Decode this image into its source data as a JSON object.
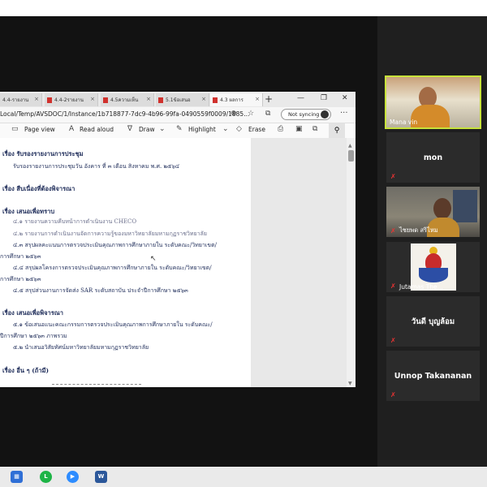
{
  "browser": {
    "tabs": [
      {
        "label": "4.4-รายงาน"
      },
      {
        "label": "4.4-2รายงาน"
      },
      {
        "label": "4.5ความเห็น"
      },
      {
        "label": "5.1ข้อเสนอ"
      },
      {
        "label": "4.3 ผลการ"
      }
    ],
    "new_tab": "+",
    "url": "Local/Temp/AVSDOC/1/Instance/1b718877-7dc9-4b96-99fa-0490559f0009/1885...",
    "sync_label": "Not syncing",
    "more": "···"
  },
  "pdf_toolbar": {
    "page_view": "Page view",
    "read_aloud": "Read aloud",
    "draw": "Draw",
    "highlight": "Highlight",
    "erase": "Erase"
  },
  "document": {
    "lines": [
      {
        "text": "เรื่อง รับรองรายงานการประชุม",
        "type": "h"
      },
      {
        "text": "รับรองรายงานการประชุมวัน อังคาร ที่ ๓ เดือน สิงหาคม พ.ศ. ๒๕๖๔",
        "type": "t"
      },
      {
        "text": "เรื่อง สืบเนื่องที่ต้องพิจารณา",
        "type": "h"
      },
      {
        "text": "เรื่อง เสนอเพื่อทราบ",
        "type": "h"
      },
      {
        "text": "๔.๑ รายงานความคืบหน้าการดำเนินงาน CHECO",
        "type": "t"
      },
      {
        "text": "๔.๒ รายงานการดำเนินงานจัดการความรู้ของมหาวิทยาลัยมหามกุฏราชวิทยาลัย",
        "type": "t"
      },
      {
        "text": "๔.๓ สรุปผลคะแนนการตรวจประเมินคุณภาพการศึกษาภายใน ระดับคณะ/วิทยาเขต/",
        "type": "t"
      },
      {
        "text": "การศึกษา ๒๕๖๓",
        "type": "t"
      },
      {
        "text": "๔.๔ สรุปผลโครงการตรวจประเมินคุณภาพการศึกษาภายใน ระดับคณะ/วิทยาเขต/",
        "type": "t"
      },
      {
        "text": "การศึกษา ๒๕๖๓",
        "type": "t"
      },
      {
        "text": "๔.๕ สรุปส่วนงานการจัดส่ง SAR ระดับสถาบัน ประจำปีการศึกษา ๒๕๖๓",
        "type": "t"
      },
      {
        "text": "เรื่อง เสนอเพื่อพิจารณา",
        "type": "h"
      },
      {
        "text": "๕.๑ ข้อเสนอแนะคณะกรรมการตรวจประเมินคุณภาพการศึกษาภายใน ระดับคณะ/",
        "type": "t"
      },
      {
        "text": "ปีการศึกษา ๒๕๖๓ ภาพรวม",
        "type": "t"
      },
      {
        "text": "๕.๒ นำเสนอวิสัยทัศน์มหาวิทยาลัยมหามกุฏราชวิทยาลัย",
        "type": "t"
      },
      {
        "text": "เรื่อง อื่น ๆ (ถ้ามี)",
        "type": "h"
      }
    ]
  },
  "participants": [
    {
      "name": "Mana vin",
      "muted": false,
      "video": "monk"
    },
    {
      "name": "mon",
      "muted": true,
      "video": "none"
    },
    {
      "name": "ไชยพด  สริไหม",
      "muted": true,
      "video": "person"
    },
    {
      "name": "Jutamas The...",
      "muted": true,
      "video": "emblem"
    },
    {
      "name": "วันดี  บุญล้อม",
      "muted": true,
      "video": "none"
    },
    {
      "name": "Unnop Takananan",
      "muted": true,
      "video": "none"
    }
  ],
  "taskbar": {
    "apps": [
      {
        "icon": "explorer-icon",
        "color": "#2f6fd6"
      },
      {
        "icon": "line-icon",
        "color": "#1db446"
      },
      {
        "icon": "zoom-icon",
        "color": "#2d8cff"
      },
      {
        "icon": "word-icon",
        "color": "#2b579a"
      }
    ]
  },
  "colors": {
    "accent": "#c7e23b",
    "muted": "#e33333",
    "doc_text": "#1f2d5a"
  }
}
